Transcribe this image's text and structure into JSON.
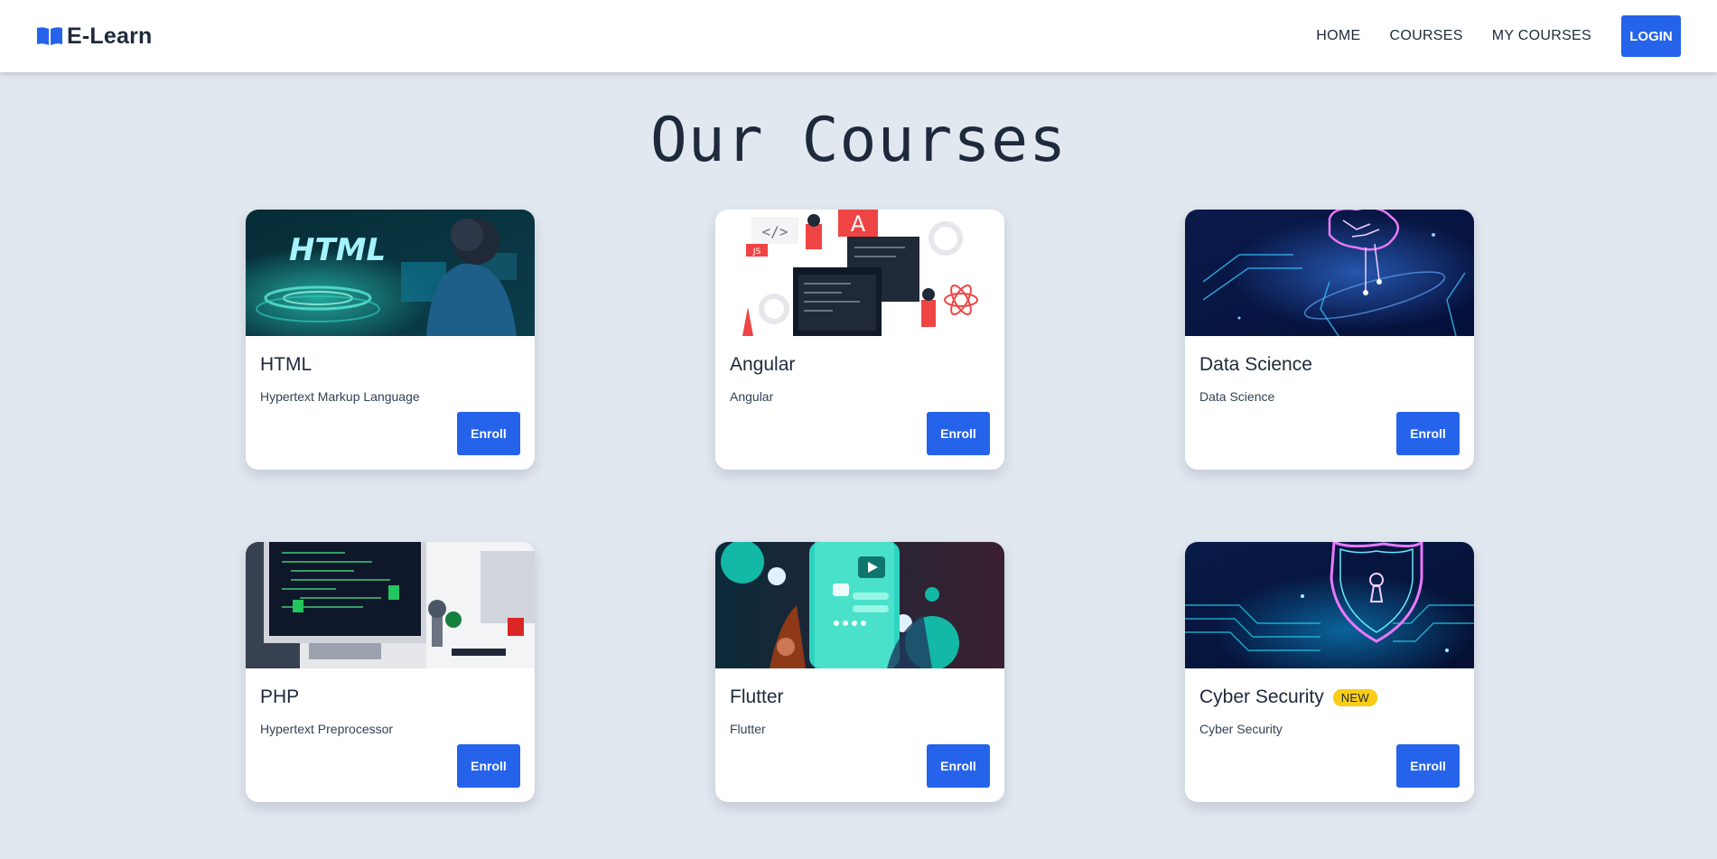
{
  "brand": {
    "name": "E-Learn",
    "icon": "open-book-icon",
    "color": "#2563eb"
  },
  "nav": {
    "links": [
      "HOME",
      "COURSES",
      "MY COURSES"
    ],
    "login_label": "LOGIN"
  },
  "page": {
    "title": "Our Courses"
  },
  "courses": [
    {
      "title": "HTML",
      "description": "Hypertext Markup Language",
      "button": "Enroll",
      "badge": "",
      "image": "html-course-image"
    },
    {
      "title": "Angular",
      "description": "Angular",
      "button": "Enroll",
      "badge": "",
      "image": "angular-course-image"
    },
    {
      "title": "Data Science",
      "description": "Data Science",
      "button": "Enroll",
      "badge": "",
      "image": "data-science-course-image"
    },
    {
      "title": "PHP",
      "description": "Hypertext Preprocessor",
      "button": "Enroll",
      "badge": "",
      "image": "php-course-image"
    },
    {
      "title": "Flutter",
      "description": "Flutter",
      "button": "Enroll",
      "badge": "",
      "image": "flutter-course-image"
    },
    {
      "title": "Cyber Security",
      "description": "Cyber Security",
      "button": "Enroll",
      "badge": "NEW",
      "image": "cyber-security-course-image"
    }
  ],
  "images": {
    "html_overlay": "HTML",
    "angular_logo": "A",
    "angular_js_tag": "JS",
    "angular_code_tag": "</>"
  },
  "colors": {
    "accent": "#2563eb",
    "badge": "#facc15",
    "background": "#e2e8f0"
  }
}
